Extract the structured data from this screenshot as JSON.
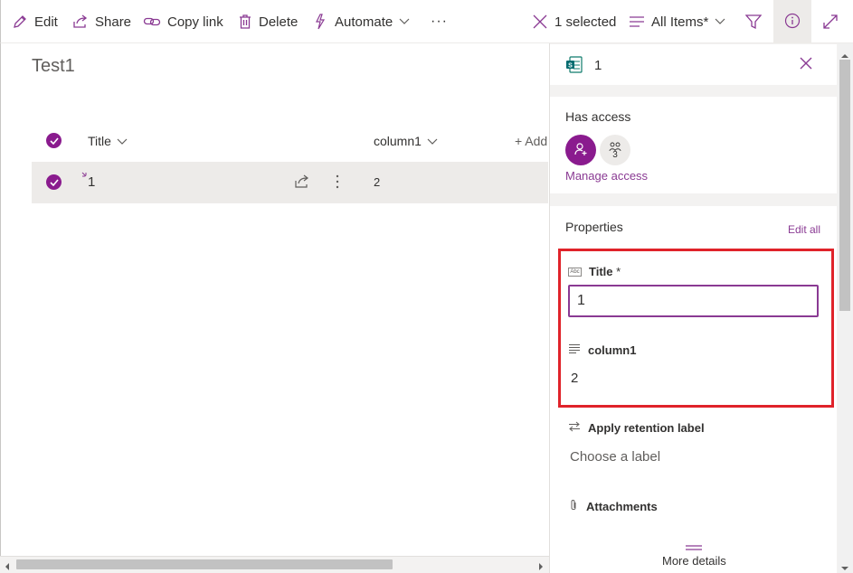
{
  "toolbar": {
    "edit": "Edit",
    "share": "Share",
    "copy_link": "Copy link",
    "delete": "Delete",
    "automate": "Automate",
    "more": "···",
    "selected": "1 selected",
    "view": "All Items*"
  },
  "list": {
    "title": "Test1",
    "columns": [
      "Title",
      "column1",
      "+ Add"
    ],
    "rows": [
      {
        "title": "1",
        "column1": "2"
      }
    ]
  },
  "panel": {
    "item_title": "1",
    "has_access": "Has access",
    "shared_count": "3",
    "manage_access": "Manage access",
    "properties": "Properties",
    "edit_all": "Edit all",
    "fields": {
      "title_label": "Title",
      "title_required": "*",
      "title_value": "1",
      "title_icon_text": "Abc",
      "column1_label": "column1",
      "column1_value": "2"
    },
    "retention_label": "Apply retention label",
    "retention_placeholder": "Choose a label",
    "attachments": "Attachments",
    "more_details": "More details"
  },
  "colors": {
    "accent": "#8a3a93",
    "highlight": "#e0232a"
  }
}
